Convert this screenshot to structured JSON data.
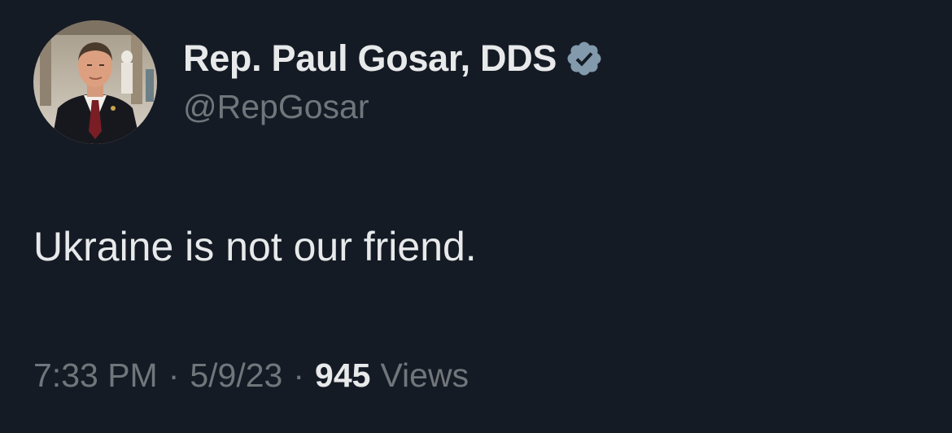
{
  "author": {
    "display_name": "Rep. Paul Gosar, DDS",
    "handle": "@RepGosar",
    "verified": true,
    "verified_badge_color": "#829aab"
  },
  "tweet": {
    "text": "Ukraine is not our friend."
  },
  "meta": {
    "time": "7:33 PM",
    "separator": "·",
    "date": "5/9/23",
    "views_count": "945",
    "views_label": "Views"
  },
  "colors": {
    "background": "#151b25",
    "primary_text": "#e7e9ea",
    "secondary_text": "#71767b"
  }
}
